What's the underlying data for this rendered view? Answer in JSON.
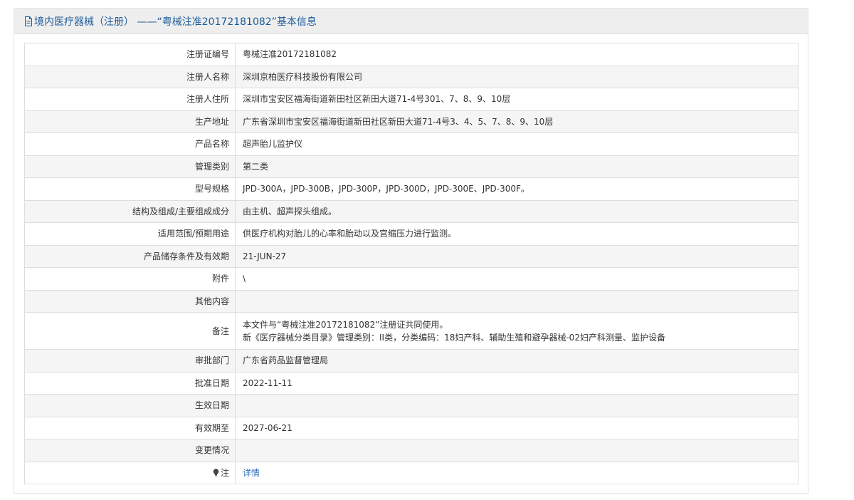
{
  "header": {
    "title": "境内医疗器械（注册） ——“粤械注准20172181082”基本信息",
    "icon": "document-icon"
  },
  "rows": [
    {
      "label": "注册证编号",
      "value": "粤械注准20172181082"
    },
    {
      "label": "注册人名称",
      "value": "深圳京柏医疗科技股份有限公司"
    },
    {
      "label": "注册人住所",
      "value": "深圳市宝安区福海街道新田社区新田大道71-4号301、7、8、9、10层"
    },
    {
      "label": "生产地址",
      "value": "广东省深圳市宝安区福海街道新田社区新田大道71-4号3、4、5、7、8、9、10层"
    },
    {
      "label": "产品名称",
      "value": "超声胎儿监护仪"
    },
    {
      "label": "管理类别",
      "value": "第二类"
    },
    {
      "label": "型号规格",
      "value": "JPD-300A，JPD-300B，JPD-300P，JPD-300D，JPD-300E、JPD-300F。"
    },
    {
      "label": "结构及组成/主要组成成分",
      "value": "由主机、超声探头组成。"
    },
    {
      "label": "适用范围/预期用途",
      "value": "供医疗机构对胎儿的心率和胎动以及宫缩压力进行监测。"
    },
    {
      "label": "产品储存条件及有效期",
      "value": "21-JUN-27"
    },
    {
      "label": "附件",
      "value": "\\"
    },
    {
      "label": "其他内容",
      "value": ""
    },
    {
      "label": "备注",
      "value_line1": "本文件与“粤械注准20172181082”注册证共同使用。",
      "value_line2": "新《医疗器械分类目录》管理类别：II类，分类编码：18妇产科、辅助生殖和避孕器械-02妇产科测量、监护设备"
    },
    {
      "label": "审批部门",
      "value": "广东省药品监督管理局"
    },
    {
      "label": "批准日期",
      "value": "2022-11-11"
    },
    {
      "label": "生效日期",
      "value": ""
    },
    {
      "label": "有效期至",
      "value": "2027-06-21"
    },
    {
      "label": "变更情况",
      "value": ""
    },
    {
      "label": "注",
      "value": "详情",
      "icon": "lightbulb-icon"
    }
  ]
}
